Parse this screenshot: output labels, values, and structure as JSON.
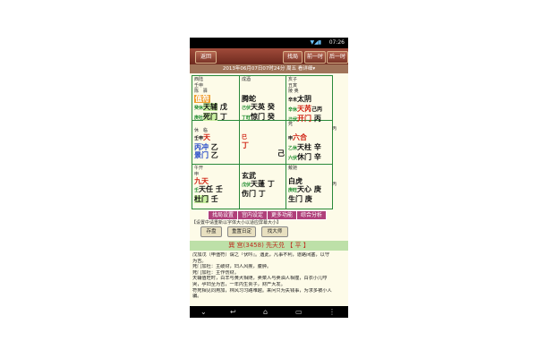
{
  "status": {
    "time": "07:26"
  },
  "toolbar": {
    "back": "返回",
    "search": "找局",
    "prev": "前一时",
    "next": "后一时"
  },
  "date_line": "2013年06月07日07时24分 周五 看详细▾",
  "cells": {
    "nw": {
      "l1": "西陆",
      "l2": "壬申",
      "l3": "陈",
      "l3b": "驿",
      "star1": "值符",
      "k1a": "癸休",
      "k1b": "天辅",
      "k1c": "戊",
      "k2a": "庚杜",
      "k2b": "死门",
      "k2c": "丁"
    },
    "n": {
      "l1": "成酒",
      "l2": "",
      "l3": "",
      "star1": "腾蛇",
      "k1a": "己伏",
      "k1b": "天英",
      "k1c": "癸",
      "k2a": "丁旺",
      "k2b": "惊门",
      "k2c": "癸"
    },
    "ne": {
      "l1": "亥子",
      "l2": "丑寅",
      "l3": "陵 奥",
      "k0": "辛未",
      "star1": "太阴",
      "k1a": "辛休",
      "k1b": "天芮",
      "k1c": "己丙",
      "k2a": "己伏",
      "k2b": "开门",
      "k2c": "丙"
    },
    "w": {
      "l1": "",
      "l2": "",
      "l3": "休",
      "l3b": "临",
      "star1": "天",
      "k0": "壬申",
      "k1a": "丙冲",
      "k1b": "",
      "k1c": "乙",
      "k2a": "",
      "k2b": "景门",
      "k2c": "乙"
    },
    "c": {
      "k0": "巳",
      "k1a": "丁",
      "k1b": "",
      "k1c": "己"
    },
    "e": {
      "l1": "死",
      "l2": "",
      "l3": "",
      "star1": "六合",
      "k0": "申",
      "k1a": "乙休",
      "k1b": "天柱",
      "k1c": "辛",
      "k2a": "六伏",
      "k2b": "休门",
      "k2c": "辛"
    },
    "sw": {
      "l1": "午开",
      "l2": "申",
      "l3": "",
      "star1": "九天",
      "k1a": "壬",
      "k1b": "天任",
      "k1c": "壬",
      "k2a": "",
      "k2b": "杜门",
      "k2c": "壬"
    },
    "s": {
      "l1": "",
      "star1": "玄武",
      "k1a": "戊伏",
      "k1b": "天蓬",
      "k1c": "丁",
      "k2a": "",
      "k2b": "伤门",
      "k2c": "丁"
    },
    "se": {
      "l1": "戴驰",
      "l2": "",
      "l3": "",
      "star1": "白虎",
      "k1a": "庚旺",
      "k1b": "天心",
      "k1c": "庚",
      "k2a": "",
      "k2b": "生门",
      "k2c": "庚"
    }
  },
  "actions": {
    "a1": "找局设置",
    "a2": "宫内设定",
    "a3": "更多功能",
    "a4": "综合分析"
  },
  "hint": "【设置中请重新以字体大小以适应屏幕大小】",
  "controls": {
    "save": "存盘",
    "restore": "重置日定",
    "find": "找大师"
  },
  "palace_title": "巽 宫(3458) 先天兑 【 平 】",
  "desc": [
    "戊加戊（甲值符）谓之『伏吟』。遇此，凡事不利，道路闭塞，以守",
    "为吉。",
    "死门加杜：主破财，妇人风疾，腹肿。",
    "死门加杜：主作伤财。",
    "天辅值旺时，白羊与黄犬相随，卖菜人与卖油人相撞，白衣小儿哼",
    "哭，孕妇至为吉，一年内生贵子，财产大发。",
    "符死相见同用加，林风习习路难越。来问只为失钱事，为求多被小人",
    "骗。"
  ]
}
